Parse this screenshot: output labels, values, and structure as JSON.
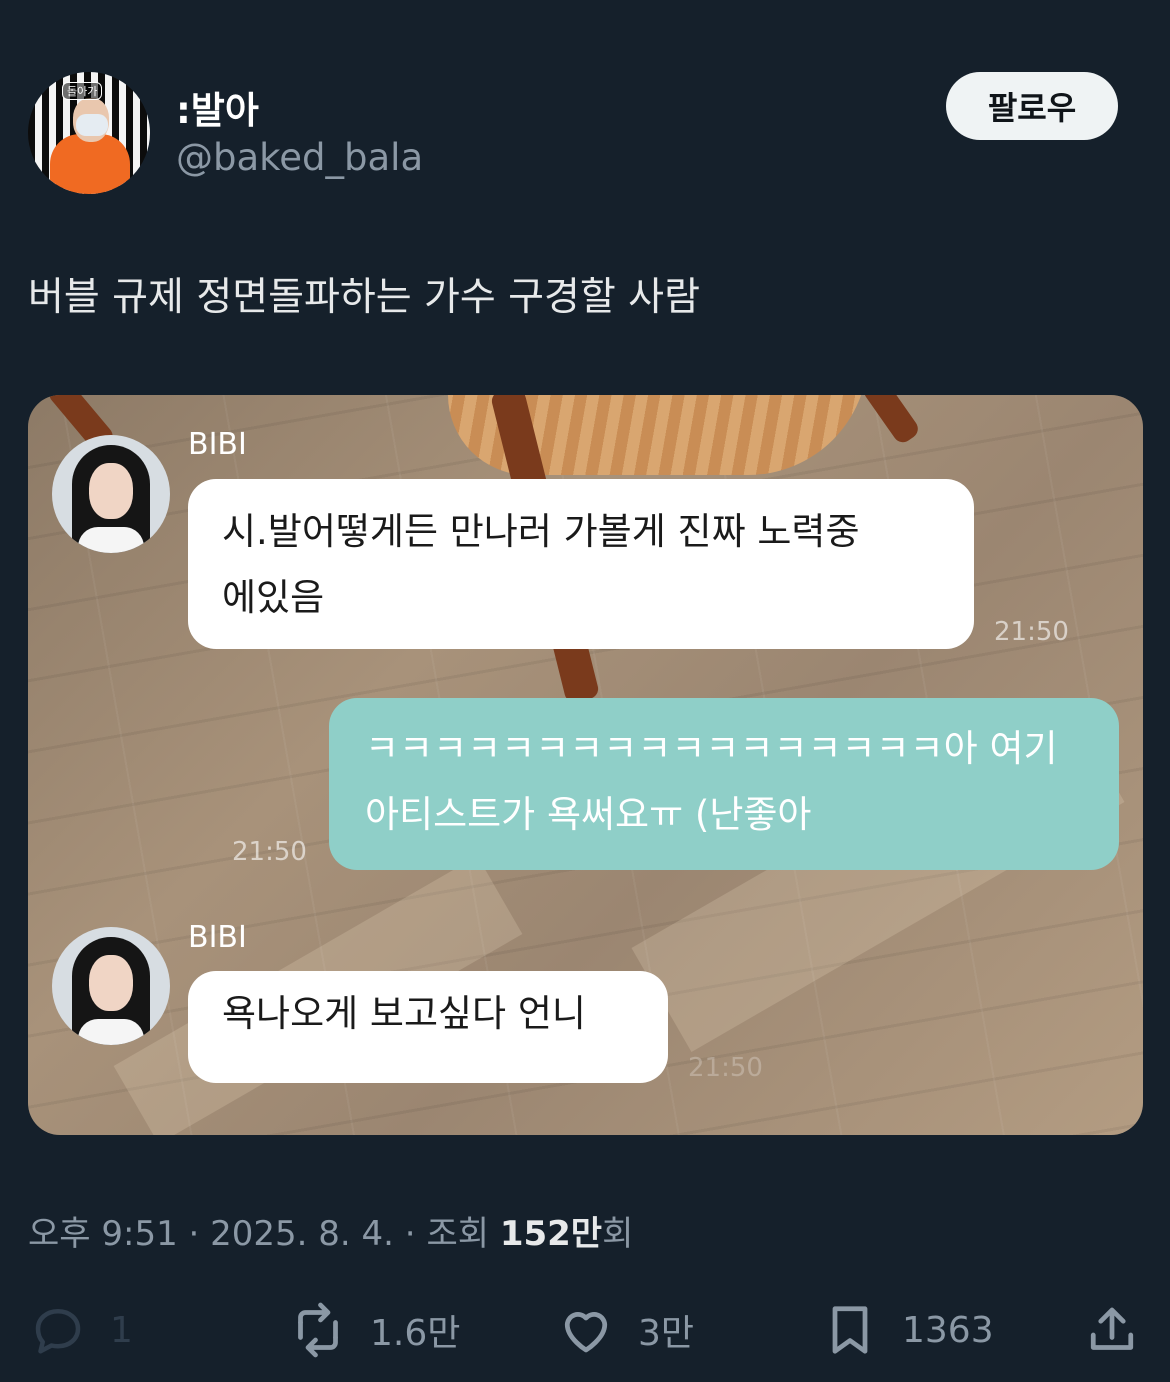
{
  "profile": {
    "avatar_caption": "돌아가",
    "display_name": ":발아",
    "handle": "@baked_bala",
    "follow_label": "팔로우"
  },
  "tweet": {
    "text": "버블 규제 정면돌파하는 가수 구경할 사람"
  },
  "chat": {
    "sender_name": "BIBI",
    "messages": [
      {
        "from": "BIBI",
        "lines": [
          "시.발어떻게든 만나러 가볼게 진짜 노력중",
          "에있음"
        ],
        "time": "21:50"
      },
      {
        "from": "me",
        "lines": [
          "ㅋㅋㅋㅋㅋㅋㅋㅋㅋㅋㅋㅋㅋㅋㅋㅋㅋ아 여기",
          "아티스트가 욕써요ㅠ (난좋아"
        ],
        "time": "21:50"
      },
      {
        "from": "BIBI",
        "lines": [
          "욕나오게 보고싶다 언니"
        ],
        "time": "21:50"
      }
    ]
  },
  "meta": {
    "time": "오후 9:51",
    "date": "2025. 8. 4.",
    "views_label": "조회",
    "views_count": "152만",
    "views_suffix": "회",
    "separator": " · "
  },
  "actions": {
    "reply": {
      "icon": "reply-icon",
      "count": "1"
    },
    "retweet": {
      "icon": "retweet-icon",
      "count": "1.6만"
    },
    "like": {
      "icon": "heart-icon",
      "count": "3만"
    },
    "bookmark": {
      "icon": "bookmark-icon",
      "count": "1363"
    },
    "share": {
      "icon": "share-icon"
    }
  },
  "colors": {
    "background": "#15202b",
    "follow_button": "#eff3f4",
    "outgoing_bubble": "#8fcfc8",
    "muted_text": "#8b98a5"
  }
}
